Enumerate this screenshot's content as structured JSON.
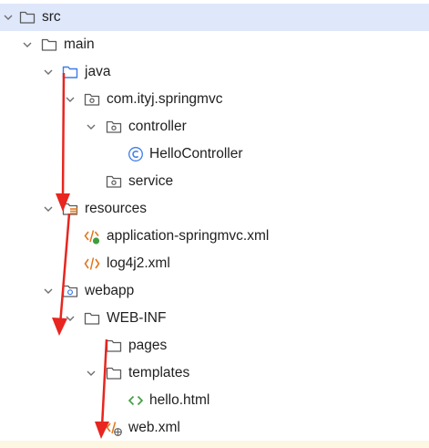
{
  "tree": {
    "items": [
      {
        "label": "src",
        "icon": "folder-icon",
        "expanded": true,
        "selected": true
      },
      {
        "label": "main",
        "icon": "folder-icon",
        "expanded": true
      },
      {
        "label": "java",
        "icon": "source-folder-icon",
        "expanded": true
      },
      {
        "label": "com.ityj.springmvc",
        "icon": "package-icon",
        "expanded": true
      },
      {
        "label": "controller",
        "icon": "package-icon",
        "expanded": true
      },
      {
        "label": "HelloController",
        "icon": "class-icon"
      },
      {
        "label": "service",
        "icon": "package-icon"
      },
      {
        "label": "resources",
        "icon": "resources-folder-icon",
        "expanded": true
      },
      {
        "label": "application-springmvc.xml",
        "icon": "spring-xml-icon"
      },
      {
        "label": "log4j2.xml",
        "icon": "xml-icon"
      },
      {
        "label": "webapp",
        "icon": "web-folder-icon",
        "expanded": true
      },
      {
        "label": "WEB-INF",
        "icon": "folder-icon",
        "expanded": true
      },
      {
        "label": "pages",
        "icon": "folder-icon"
      },
      {
        "label": "templates",
        "icon": "folder-icon",
        "expanded": true
      },
      {
        "label": "hello.html",
        "icon": "html-icon"
      },
      {
        "label": "web.xml",
        "icon": "web-xml-icon"
      }
    ]
  },
  "colors": {
    "selection": "#dfe7fb",
    "folder": "#5a5a5a",
    "source_folder": "#3d7be8",
    "class": "#3d7be8",
    "xml": "#e2761b",
    "html": "#3e9d3e",
    "annotation_arrow": "#e8251f"
  }
}
